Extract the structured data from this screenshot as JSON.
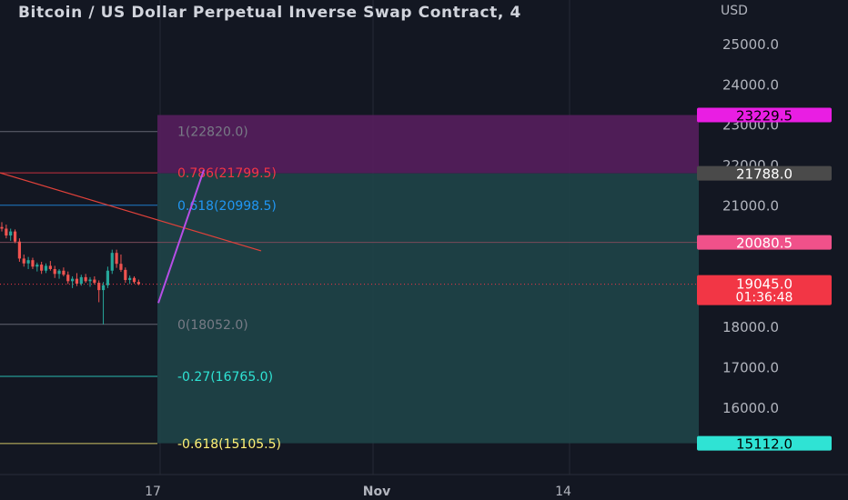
{
  "chart_data": {
    "type": "candlestick",
    "title": "Bitcoin / US Dollar Perpetual Inverse Swap Contract, 4",
    "currency": "USD",
    "y_axis": {
      "ticks": [
        25000,
        24000,
        23000,
        22000,
        21000,
        18000,
        17000,
        16000
      ],
      "tick_labels": [
        "25000.0",
        "24000.0",
        "23000.0",
        "22000.0",
        "21000.0",
        "18000.0",
        "17000.0",
        "16000.0"
      ],
      "range": [
        14900,
        25400
      ]
    },
    "x_axis": {
      "tick_labels": [
        "17",
        "Nov",
        "14"
      ]
    },
    "price_badges": [
      {
        "label": "23229.5",
        "value": 23229.5,
        "color": "#e91ee3",
        "text_color": "#000000"
      },
      {
        "label": "21788.0",
        "value": 21788.0,
        "color": "#4a4a4a",
        "text_color": "#ffffff"
      },
      {
        "label": "20080.5",
        "value": 20080.5,
        "color": "#f0518a",
        "text_color": "#ffffff"
      },
      {
        "label": "15112.0",
        "value": 15112.0,
        "color": "#2fe3d4",
        "text_color": "#000000"
      }
    ],
    "last_price": {
      "label": "19045.0",
      "countdown": "01:36:48",
      "value": 19045.0,
      "color": "#f23645"
    },
    "fib_levels": [
      {
        "label": "1(22820.0)",
        "value": 22820.0,
        "color": "#787b86"
      },
      {
        "label": "0.786(21799.5)",
        "value": 21799.5,
        "color": "#f23645"
      },
      {
        "label": "0.618(20998.5)",
        "value": 20998.5,
        "color": "#2196f3"
      },
      {
        "label": "0(18052.0)",
        "value": 18052.0,
        "color": "#787b86"
      },
      {
        "label": "-0.27(16765.0)",
        "value": 16765.0,
        "color": "#2fe3d4"
      },
      {
        "label": "-0.618(15105.5)",
        "value": 15105.5,
        "color": "#fff176"
      }
    ],
    "target_zone": {
      "top": 23229.5,
      "entry": 21788.0,
      "bottom": 15112.0
    },
    "candles": [
      {
        "o": 20460,
        "h": 20580,
        "l": 20350,
        "c": 20420
      },
      {
        "o": 20420,
        "h": 20520,
        "l": 20180,
        "c": 20250
      },
      {
        "o": 20250,
        "h": 20420,
        "l": 20120,
        "c": 20350
      },
      {
        "o": 20350,
        "h": 20400,
        "l": 20060,
        "c": 20100
      },
      {
        "o": 20100,
        "h": 20180,
        "l": 19600,
        "c": 19680
      },
      {
        "o": 19680,
        "h": 19780,
        "l": 19480,
        "c": 19560
      },
      {
        "o": 19560,
        "h": 19720,
        "l": 19420,
        "c": 19640
      },
      {
        "o": 19640,
        "h": 19700,
        "l": 19420,
        "c": 19480
      },
      {
        "o": 19480,
        "h": 19580,
        "l": 19360,
        "c": 19530
      },
      {
        "o": 19530,
        "h": 19600,
        "l": 19300,
        "c": 19380
      },
      {
        "o": 19380,
        "h": 19560,
        "l": 19320,
        "c": 19500
      },
      {
        "o": 19500,
        "h": 19620,
        "l": 19380,
        "c": 19420
      },
      {
        "o": 19420,
        "h": 19500,
        "l": 19200,
        "c": 19300
      },
      {
        "o": 19300,
        "h": 19420,
        "l": 19180,
        "c": 19380
      },
      {
        "o": 19380,
        "h": 19460,
        "l": 19240,
        "c": 19280
      },
      {
        "o": 19280,
        "h": 19360,
        "l": 19050,
        "c": 19120
      },
      {
        "o": 19120,
        "h": 19240,
        "l": 18950,
        "c": 19180
      },
      {
        "o": 19180,
        "h": 19320,
        "l": 19000,
        "c": 19060
      },
      {
        "o": 19060,
        "h": 19280,
        "l": 19010,
        "c": 19220
      },
      {
        "o": 19220,
        "h": 19300,
        "l": 19080,
        "c": 19120
      },
      {
        "o": 19120,
        "h": 19220,
        "l": 18980,
        "c": 19160
      },
      {
        "o": 19160,
        "h": 19240,
        "l": 19040,
        "c": 19080
      },
      {
        "o": 19080,
        "h": 19140,
        "l": 18600,
        "c": 18900
      },
      {
        "o": 18900,
        "h": 19100,
        "l": 18052,
        "c": 19020
      },
      {
        "o": 19020,
        "h": 19480,
        "l": 18950,
        "c": 19380
      },
      {
        "o": 19380,
        "h": 19900,
        "l": 19300,
        "c": 19820
      },
      {
        "o": 19820,
        "h": 19900,
        "l": 19450,
        "c": 19550
      },
      {
        "o": 19550,
        "h": 19780,
        "l": 19350,
        "c": 19400
      },
      {
        "o": 19400,
        "h": 19460,
        "l": 19080,
        "c": 19150
      },
      {
        "o": 19150,
        "h": 19260,
        "l": 19050,
        "c": 19200
      },
      {
        "o": 19200,
        "h": 19240,
        "l": 19060,
        "c": 19100
      },
      {
        "o": 19100,
        "h": 19160,
        "l": 19020,
        "c": 19045
      }
    ],
    "red_trendline": {
      "from": 21800,
      "to": 19870
    },
    "projection_line": {
      "from": 18580,
      "to": 21870
    }
  }
}
